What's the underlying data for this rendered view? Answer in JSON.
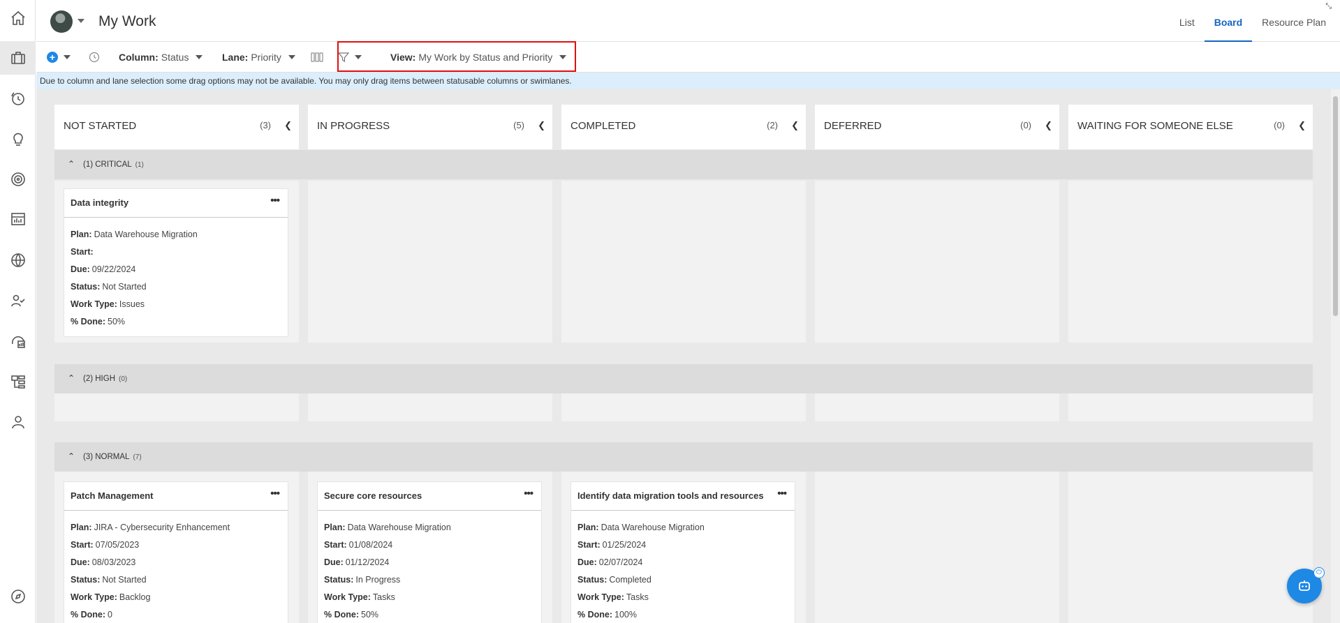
{
  "header": {
    "title": "My Work",
    "tabs": [
      {
        "label": "List",
        "active": false
      },
      {
        "label": "Board",
        "active": true
      },
      {
        "label": "Resource Plan",
        "active": false
      }
    ],
    "expand_icon": "⤡"
  },
  "toolbar": {
    "add_icon": "+",
    "column_label": "Column:",
    "column_value": "Status",
    "lane_label": "Lane:",
    "lane_value": "Priority",
    "view_label": "View:",
    "view_value": "My Work by Status and Priority"
  },
  "notice": "Due to column and lane selection some drag options may not be available. You may only drag items between statusable columns or swimlanes.",
  "columns": [
    {
      "title": "NOT STARTED",
      "count": "(3)"
    },
    {
      "title": "IN PROGRESS",
      "count": "(5)"
    },
    {
      "title": "COMPLETED",
      "count": "(2)"
    },
    {
      "title": "DEFERRED",
      "count": "(0)"
    },
    {
      "title": "WAITING FOR SOMEONE ELSE",
      "count": "(0)"
    }
  ],
  "lanes": [
    {
      "title": "(1) CRITICAL",
      "count": "(1)"
    },
    {
      "title": "(2) HIGH",
      "count": "(0)"
    },
    {
      "title": "(3) NORMAL",
      "count": "(7)"
    }
  ],
  "field_labels": {
    "plan": "Plan:",
    "start": "Start:",
    "due": "Due:",
    "status": "Status:",
    "work_type": "Work Type:",
    "done": "% Done:"
  },
  "cards": [
    {
      "title": "Data integrity",
      "plan": "Data Warehouse Migration",
      "start": "",
      "due": "09/22/2024",
      "status": "Not Started",
      "work_type": "Issues",
      "done": "50%"
    },
    {
      "title": "Patch Management",
      "plan": "JIRA - Cybersecurity Enhancement",
      "start": "07/05/2023",
      "due": "08/03/2023",
      "status": "Not Started",
      "work_type": "Backlog",
      "done": "0"
    },
    {
      "title": "Secure core resources",
      "plan": "Data Warehouse Migration",
      "start": "01/08/2024",
      "due": "01/12/2024",
      "status": "In Progress",
      "work_type": "Tasks",
      "done": "50%"
    },
    {
      "title": "Identify data migration tools and resources",
      "plan": "Data Warehouse Migration",
      "start": "01/25/2024",
      "due": "02/07/2024",
      "status": "Completed",
      "work_type": "Tasks",
      "done": "100%"
    }
  ],
  "card_menu": "•••",
  "collapse_glyph": "❮",
  "lane_toggle_glyph": "⌃",
  "fab_badge": "⏻"
}
